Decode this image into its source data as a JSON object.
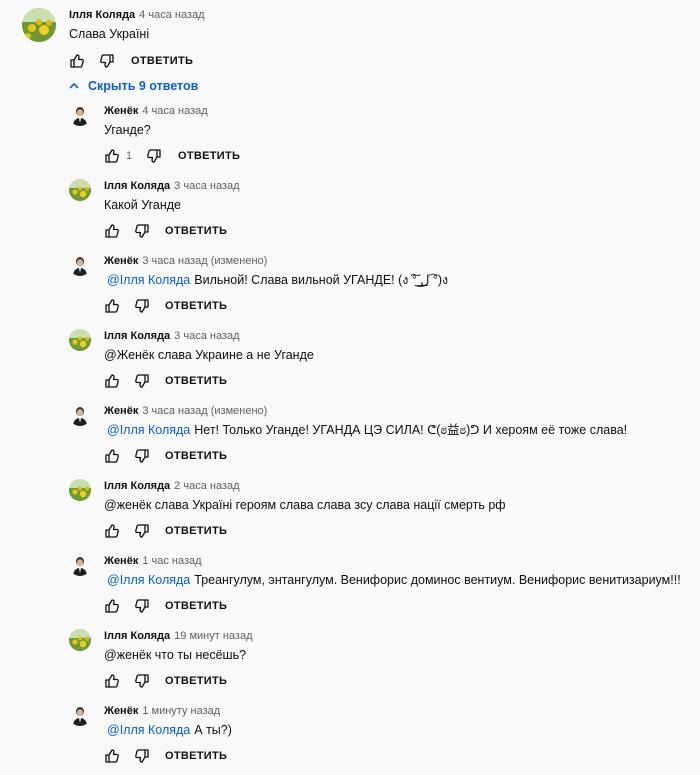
{
  "root": {
    "author": "Ілля Коляда",
    "time": "4 часа назад",
    "text": "Слава Україні",
    "reply_label": "ОТВЕТИТЬ"
  },
  "toggle_label": "Скрыть 9 ответов",
  "replies": [
    {
      "author": "Женёк",
      "time": "4 часа назад",
      "mention": "",
      "text": "Уганде?",
      "likes": "1",
      "reply_label": "ОТВЕТИТЬ"
    },
    {
      "author": "Ілля Коляда",
      "time": "3 часа назад",
      "mention": "",
      "text": "Какой Уганде",
      "likes": "",
      "reply_label": "ОТВЕТИТЬ"
    },
    {
      "author": "Женёк",
      "time": "3 часа назад (изменено)",
      "mention": "@Ілля Коляда",
      "text": "Вильной! Слава вильной УГАНДЕ! (ง ͠° ͟ل͜ ͡°)ง",
      "likes": "",
      "reply_label": "ОТВЕТИТЬ"
    },
    {
      "author": "Ілля Коляда",
      "time": "3 часа назад",
      "mention": "",
      "text": "@Женёк  слава Украине а не Уганде",
      "likes": "",
      "reply_label": "ОТВЕТИТЬ"
    },
    {
      "author": "Женёк",
      "time": "3 часа назад (изменено)",
      "mention": "@Ілля Коляда",
      "text": "Нет! Только Уганде! УГАНДА ЦЭ СИЛА!  ᕦ(ಠ益ಠ)ᕤ И хероям её тоже слава!",
      "likes": "",
      "reply_label": "ОТВЕТИТЬ"
    },
    {
      "author": "Ілля Коляда",
      "time": "2 часа назад",
      "mention": "",
      "text": "@женёк слава Україні героям слава слава зсу слава нації смерть рф",
      "likes": "",
      "reply_label": "ОТВЕТИТЬ"
    },
    {
      "author": "Женёк",
      "time": "1 час назад",
      "mention": "@Ілля Коляда",
      "text": "Треангулум, энтангулум. Венифорис доминос вентиум. Венифорис венитизариум!!!",
      "likes": "",
      "reply_label": "ОТВЕТИТЬ"
    },
    {
      "author": "Ілля Коляда",
      "time": "19 минут назад",
      "mention": "",
      "text": "@женёк что ты несёшь?",
      "likes": "",
      "reply_label": "ОТВЕТИТЬ"
    },
    {
      "author": "Женёк",
      "time": "1 минуту назад",
      "mention": "@Ілля Коляда",
      "text": "А ты?)",
      "likes": "",
      "reply_label": "ОТВЕТИТЬ"
    }
  ],
  "colors": {
    "mention": "#065fd4",
    "toggle": "#065fd4",
    "text": "#0f0f0f",
    "secondary": "#606060",
    "background": "#f9f9f9"
  },
  "avatars": {
    "ilya": "sunflower-field-avatar",
    "zhenek": "man-in-suit-avatar"
  }
}
